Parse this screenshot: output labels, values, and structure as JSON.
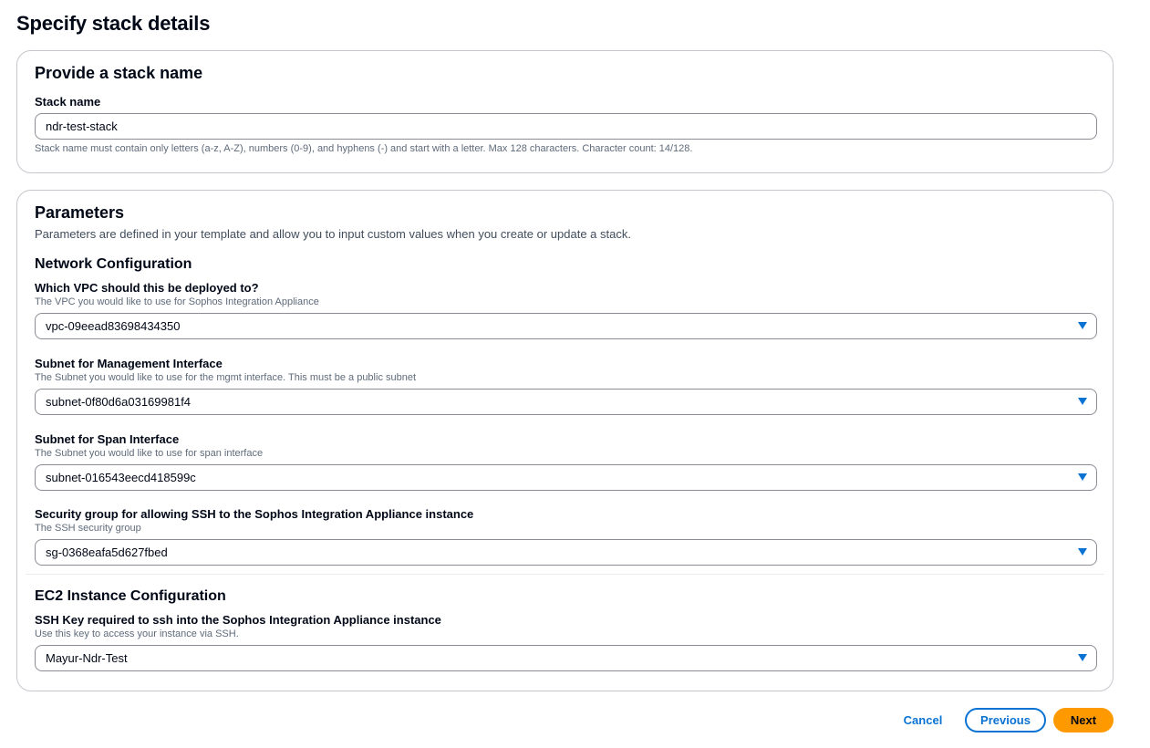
{
  "page": {
    "title": "Specify stack details"
  },
  "stack_name_section": {
    "title": "Provide a stack name",
    "field_label": "Stack name",
    "value": "ndr-test-stack",
    "constraint": "Stack name must contain only letters (a-z, A-Z), numbers (0-9), and hyphens (-) and start with a letter. Max 128 characters. Character count: 14/128."
  },
  "parameters_section": {
    "title": "Parameters",
    "description": "Parameters are defined in your template and allow you to input custom values when you create or update a stack.",
    "network": {
      "title": "Network Configuration",
      "fields": [
        {
          "label": "Which VPC should this be deployed to?",
          "description": "The VPC you would like to use for Sophos Integration Appliance",
          "value": "vpc-09eead83698434350"
        },
        {
          "label": "Subnet for Management Interface",
          "description": "The Subnet you would like to use for the mgmt interface. This must be a public subnet",
          "value": "subnet-0f80d6a03169981f4"
        },
        {
          "label": "Subnet for Span Interface",
          "description": "The Subnet you would like to use for span interface",
          "value": "subnet-016543eecd418599c"
        },
        {
          "label": "Security group for allowing SSH to the Sophos Integration Appliance instance",
          "description": "The SSH security group",
          "value": "sg-0368eafa5d627fbed"
        }
      ]
    },
    "ec2": {
      "title": "EC2 Instance Configuration",
      "fields": [
        {
          "label": "SSH Key required to ssh into the Sophos Integration Appliance instance",
          "description": "Use this key to access your instance via SSH.",
          "value": "Mayur-Ndr-Test"
        }
      ]
    }
  },
  "actions": {
    "cancel": "Cancel",
    "previous": "Previous",
    "next": "Next"
  },
  "icons": {
    "select_caret": "caret-down-icon"
  },
  "colors": {
    "link_blue": "#0972d3",
    "primary_orange": "#ff9900",
    "text_dark": "#000716",
    "border_gray": "#c6c6cd"
  }
}
